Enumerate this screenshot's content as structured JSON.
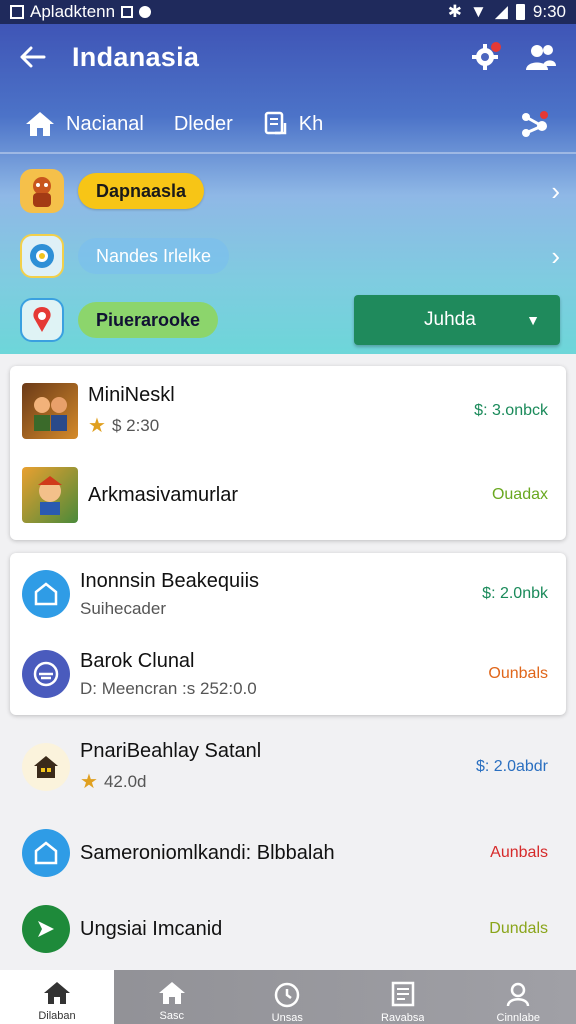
{
  "status_bar": {
    "app_text": "Apladktenn",
    "time": "9:30"
  },
  "app_bar": {
    "title": "Indanasia"
  },
  "tabs": [
    {
      "label": "Nacianal"
    },
    {
      "label": "Dleder"
    },
    {
      "label": "Kh"
    }
  ],
  "header_rows": {
    "row1": {
      "pill": "Dapnaasla"
    },
    "row2": {
      "pill": "Nandes Irlelke"
    },
    "row3": {
      "pill": "Piuerarooke",
      "dropdown": "Juhda"
    }
  },
  "card1": {
    "items": [
      {
        "title": "MiniNeskl",
        "sub": "$ 2:30",
        "price": "$: 3.onbck",
        "price_color": "#1a8a5a"
      },
      {
        "title": "Arkmasivamurlar",
        "price": "Ouadax",
        "price_color": "#6aa820"
      }
    ]
  },
  "card2": {
    "items": [
      {
        "title": "Inonnsin Beakequiis",
        "sub": "Suihecader",
        "price": "$: 2.0nbk",
        "price_color": "#1a8a5a"
      },
      {
        "title": "Barok Clunal",
        "sub": "D: Meencran :s 252:0.0",
        "price": "Ounbals",
        "price_color": "#e0661a"
      }
    ]
  },
  "list": {
    "items": [
      {
        "title": "PnariBeahlay Satanl",
        "sub": "42.0d",
        "price": "$: 2.0abdr",
        "price_color": "#2a6fc0"
      },
      {
        "title": "Sameroniomlkandi: Blbbalah",
        "price": "Aunbals",
        "price_color": "#d62a2a"
      },
      {
        "title": "Ungsiai Imcanid",
        "price": "Dundals",
        "price_color": "#8aa51a"
      }
    ]
  },
  "bottom_nav": [
    {
      "label": "Dilaban",
      "icon": "home-icon"
    },
    {
      "label": "Sasc",
      "icon": "home-icon"
    },
    {
      "label": "Unsas",
      "icon": "timer-icon"
    },
    {
      "label": "Ravabsa",
      "icon": "receipt-icon"
    },
    {
      "label": "Cinnlabe",
      "icon": "user-icon"
    }
  ],
  "colors": {
    "header_top": "#3f55b6",
    "header_bottom": "#6dd6d9",
    "dropdown": "#1f8a5c",
    "pill_yellow": "#f7c516",
    "pill_green": "#8cd56c"
  }
}
